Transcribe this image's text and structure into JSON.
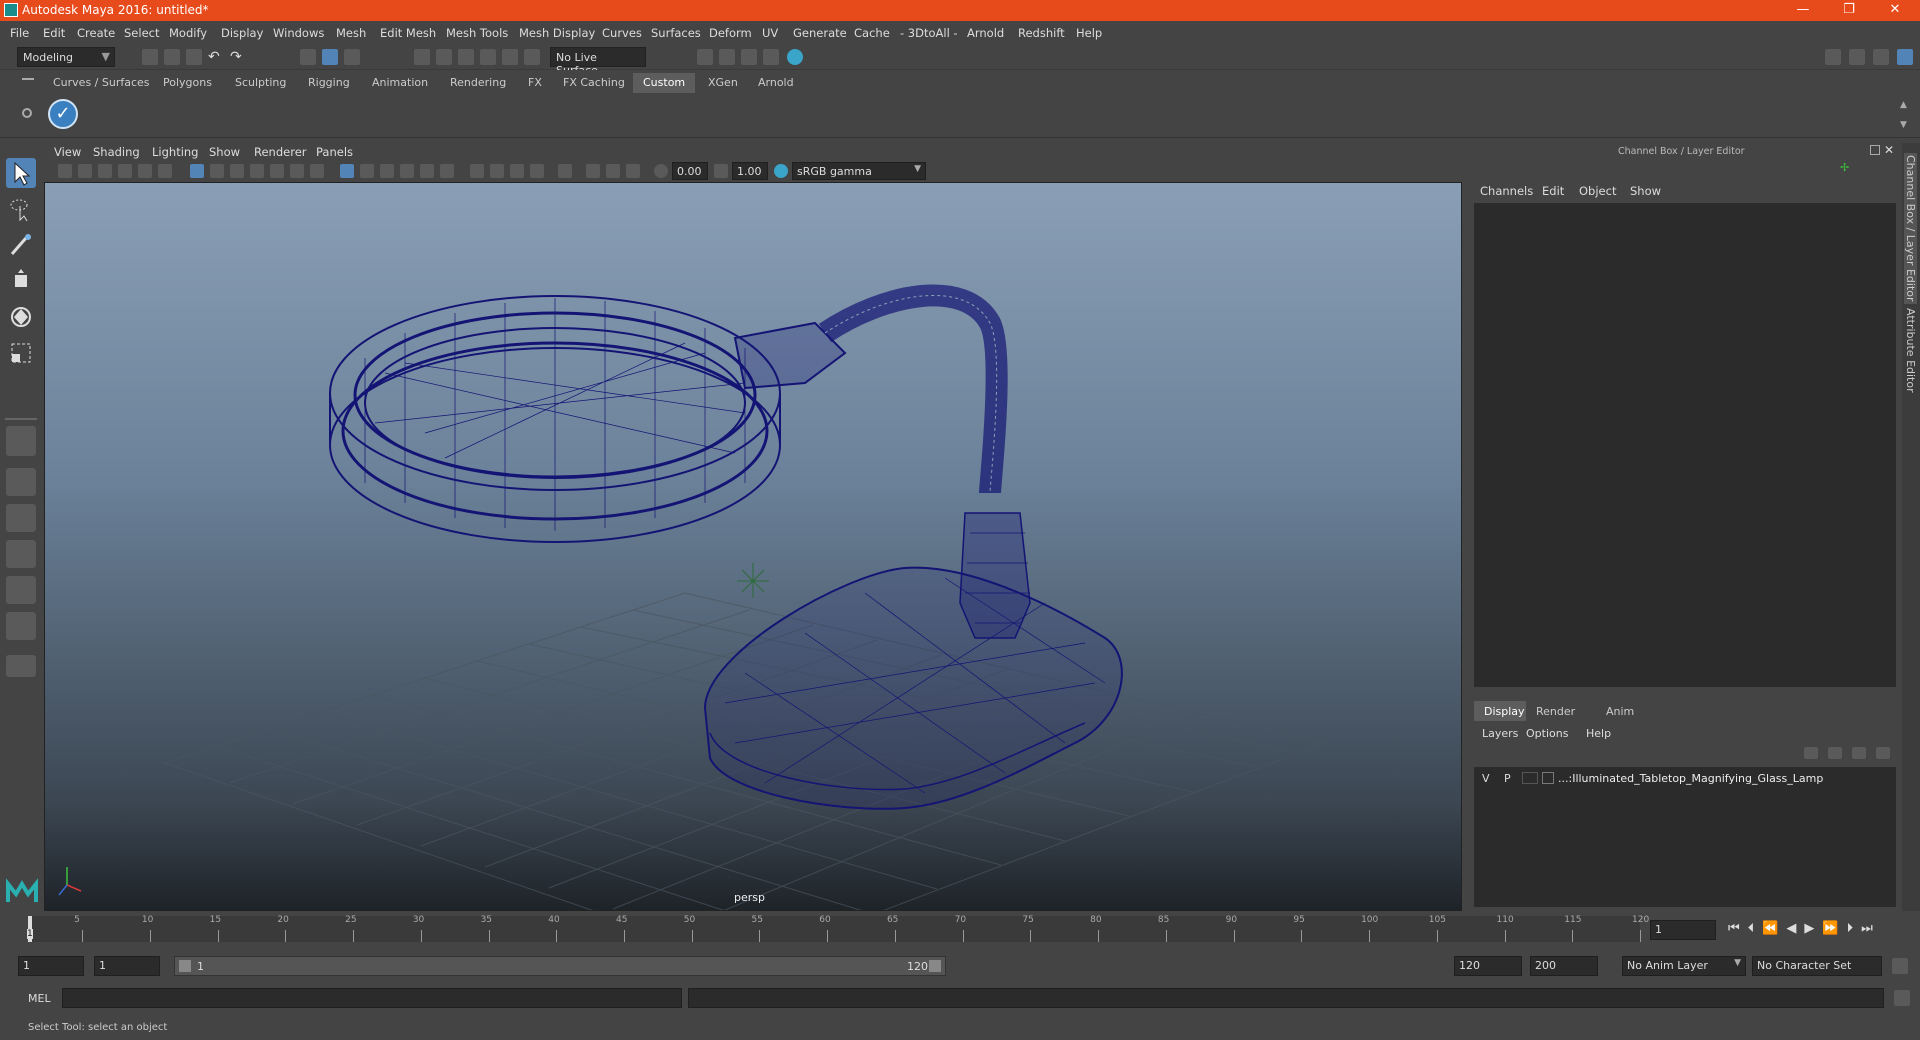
{
  "window": {
    "title": "Autodesk Maya 2016: untitled*",
    "minimize": "—",
    "maximize": "❐",
    "close": "✕"
  },
  "menubar": [
    "File",
    "Edit",
    "Create",
    "Select",
    "Modify",
    "Display",
    "Windows",
    "Mesh",
    "Edit Mesh",
    "Mesh Tools",
    "Mesh Display",
    "Curves",
    "Surfaces",
    "Deform",
    "UV",
    "Generate",
    "Cache",
    "- 3DtoAll -",
    "Arnold",
    "Redshift",
    "Help"
  ],
  "statusline": {
    "mode": "Modeling",
    "live_surface": "No Live Surface"
  },
  "shelf": {
    "tabs": [
      "Curves / Surfaces",
      "Polygons",
      "Sculpting",
      "Rigging",
      "Animation",
      "Rendering",
      "FX",
      "FX Caching",
      "Custom",
      "XGen",
      "Arnold"
    ],
    "active_tab": "Custom"
  },
  "viewport": {
    "menus": [
      "View",
      "Shading",
      "Lighting",
      "Show",
      "Renderer",
      "Panels"
    ],
    "exposure": "0.00",
    "gamma": "1.00",
    "color_space": "sRGB gamma",
    "camera_label": "persp"
  },
  "channel_box": {
    "header": "Channel Box / Layer Editor",
    "menus": [
      "Channels",
      "Edit",
      "Object",
      "Show"
    ]
  },
  "layer_editor": {
    "tabs": [
      "Display",
      "Render",
      "Anim"
    ],
    "active_tab": "Display",
    "menus": [
      "Layers",
      "Options",
      "Help"
    ],
    "layer": {
      "v": "V",
      "p": "P",
      "name": "...:Illuminated_Tabletop_Magnifying_Glass_Lamp"
    }
  },
  "side_tabs": [
    "Channel Box / Layer Editor",
    "Attribute Editor"
  ],
  "timeline": {
    "ticks": [
      "5",
      "10",
      "15",
      "20",
      "25",
      "30",
      "35",
      "40",
      "45",
      "50",
      "55",
      "60",
      "65",
      "70",
      "75",
      "80",
      "85",
      "90",
      "95",
      "100",
      "105",
      "110",
      "115",
      "120"
    ],
    "start_marker": "1",
    "current_frame": "1"
  },
  "range": {
    "start": "1",
    "playback_start": "1",
    "slider_start": "1",
    "slider_end": "120",
    "playback_end": "120",
    "end": "200",
    "anim_layer": "No Anim Layer",
    "character_set": "No Character Set"
  },
  "cmdline": {
    "label": "MEL"
  },
  "helpline": {
    "text": "Select Tool: select an object"
  }
}
